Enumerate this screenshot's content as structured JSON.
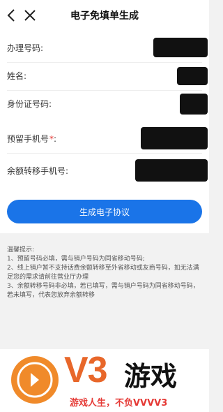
{
  "header": {
    "title": "电子免填单生成"
  },
  "form": {
    "fields": [
      {
        "label": "办理号码:",
        "required": false
      },
      {
        "label": "姓名:",
        "required": false
      },
      {
        "label": "身份证号码:",
        "required": false
      },
      {
        "label": "预留手机号",
        "required": true,
        "required_mark": "*",
        "suffix": ":"
      },
      {
        "label": "余额转移手机号:",
        "required": false
      }
    ]
  },
  "actions": {
    "generate_label": "生成电子协议"
  },
  "tips": {
    "title": "温馨提示:",
    "items": [
      "1、预留号码必填，需与销户号码为同省移动号码;",
      "2、线上销户暂不支持话费余额转移至外省移动或友商号码，如无法满足您的需求请前往营业厅办理",
      "3、余额转移号码非必填，若已填写，需与销户号码为同省移动号码，若未填写，代表您放弃余额转移"
    ]
  },
  "watermark": {
    "brand": "V3",
    "name": "游戏",
    "slogan": "游戏人生，不负VVVV3",
    "colors": {
      "brand": "#e8672a",
      "slogan": "#e53935"
    }
  },
  "colors": {
    "accent": "#1a74e8",
    "required": "#e53935",
    "redaction": "#111111"
  }
}
